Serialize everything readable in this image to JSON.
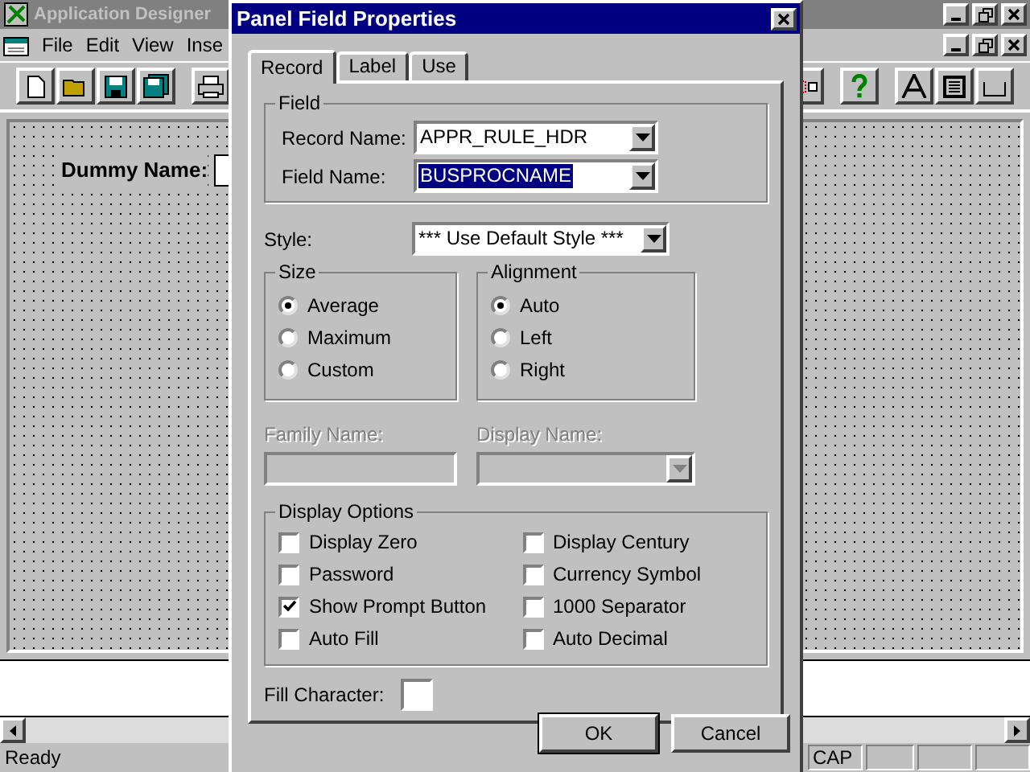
{
  "app": {
    "title": "Application Designer",
    "menu": [
      "File",
      "Edit",
      "View",
      "Inse"
    ],
    "canvas_label": "Dummy Name:",
    "status": "Ready",
    "indicators": [
      "CAP"
    ]
  },
  "dialog": {
    "title": "Panel Field Properties",
    "tabs": [
      {
        "label": "Record",
        "selected": true
      },
      {
        "label": "Label",
        "selected": false
      },
      {
        "label": "Use",
        "selected": false
      }
    ],
    "field_group": {
      "title": "Field",
      "record_name": {
        "label": "Record Name:",
        "value": "APPR_RULE_HDR",
        "selected": false
      },
      "field_name": {
        "label": "Field Name:",
        "value": "BUSPROCNAME",
        "selected": true
      }
    },
    "style": {
      "label": "Style:",
      "value": "*** Use Default Style ***"
    },
    "size": {
      "title": "Size",
      "options": [
        {
          "label": "Average",
          "selected": true
        },
        {
          "label": "Maximum",
          "selected": false
        },
        {
          "label": "Custom",
          "selected": false
        }
      ]
    },
    "alignment": {
      "title": "Alignment",
      "options": [
        {
          "label": "Auto",
          "selected": true
        },
        {
          "label": "Left",
          "selected": false
        },
        {
          "label": "Right",
          "selected": false
        }
      ]
    },
    "family_name": {
      "label": "Family Name:",
      "disabled": true
    },
    "display_name": {
      "label": "Display Name:",
      "disabled": true
    },
    "display_options": {
      "title": "Display Options",
      "options": [
        {
          "label": "Display Zero",
          "checked": false
        },
        {
          "label": "Display Century",
          "checked": false
        },
        {
          "label": "Password",
          "checked": false
        },
        {
          "label": "Currency Symbol",
          "checked": false
        },
        {
          "label": "Show Prompt Button",
          "checked": true
        },
        {
          "label": "1000 Separator",
          "checked": false
        },
        {
          "label": "Auto Fill",
          "checked": false
        },
        {
          "label": "Auto Decimal",
          "checked": false
        }
      ]
    },
    "fill_character": {
      "label": "Fill Character:"
    },
    "buttons": [
      "OK",
      "Cancel"
    ]
  }
}
